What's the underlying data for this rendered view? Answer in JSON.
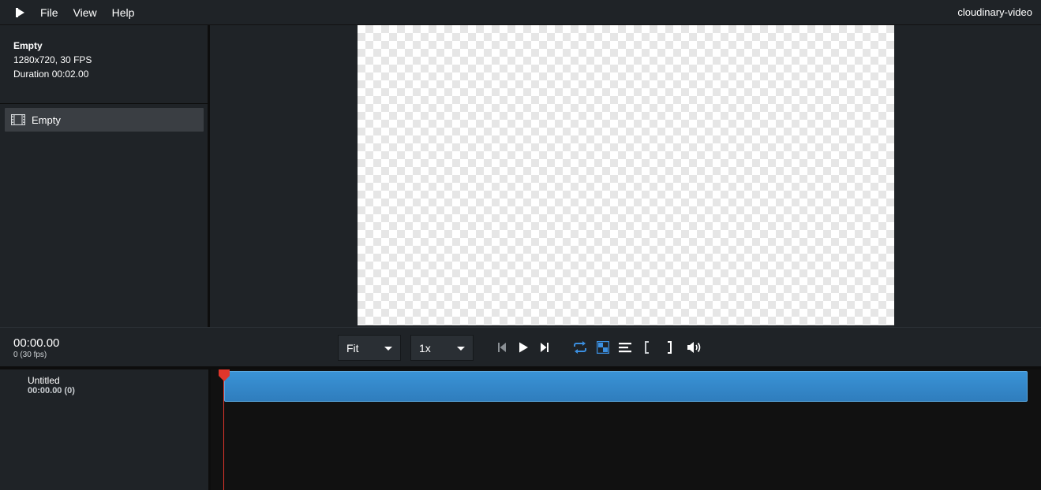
{
  "menubar": {
    "logo_icon": "play-logo-icon",
    "items": [
      "File",
      "View",
      "Help"
    ],
    "app_name": "cloudinary-video"
  },
  "project": {
    "title": "Empty",
    "resolution": "1280x720, 30 FPS",
    "duration": "Duration 00:02.00"
  },
  "sequence_list": {
    "items": [
      {
        "icon": "film-icon",
        "label": "Empty"
      }
    ]
  },
  "controls": {
    "timecode": "00:00.00",
    "frame_info": "0 (30 fps)",
    "zoom_select": "Fit",
    "speed_select": "1x",
    "icons": [
      "skip-back-icon",
      "play-icon",
      "skip-forward-icon",
      "loop-icon",
      "transparency-checker-icon",
      "align-icon",
      "mark-in-icon",
      "mark-out-icon",
      "volume-icon"
    ],
    "accent_color": "#3b8fe0"
  },
  "timeline": {
    "track_name": "Untitled",
    "track_time": "00:00.00 (0)",
    "clip_color": "#3a93d6",
    "playhead_color": "#e0362b"
  }
}
